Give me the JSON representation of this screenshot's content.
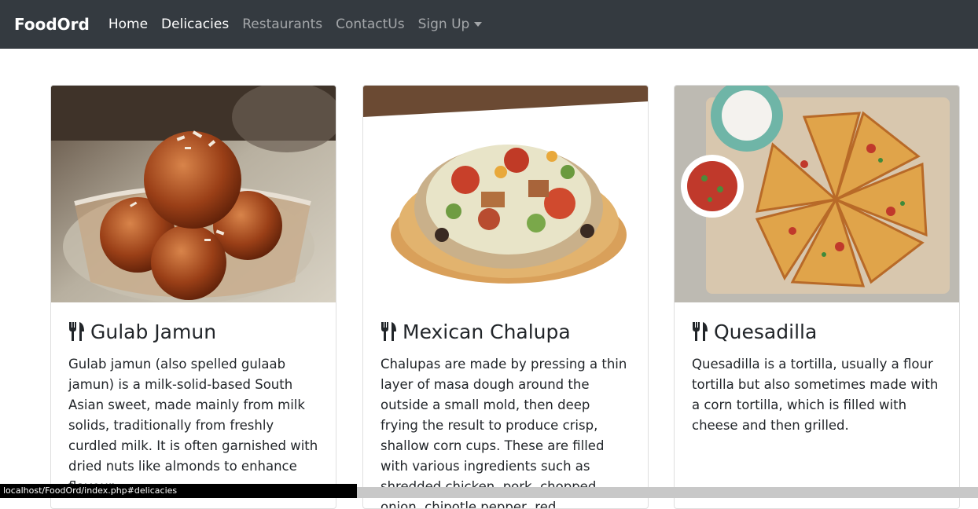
{
  "navbar": {
    "brand": "FoodOrd",
    "items": [
      {
        "label": "Home"
      },
      {
        "label": "Delicacies"
      },
      {
        "label": "Restaurants"
      },
      {
        "label": "ContactUs"
      },
      {
        "label": "Sign Up"
      }
    ]
  },
  "cards": [
    {
      "title": "Gulab Jamun",
      "text": "Gulab jamun (also spelled gulaab jamun) is a milk-solid-based South Asian sweet, made mainly from milk solids, traditionally from freshly curdled milk. It is often garnished with dried nuts like almonds to enhance flavour."
    },
    {
      "title": "Mexican Chalupa",
      "text": "Chalupas are made by pressing a thin layer of masa dough around the outside a small mold, then deep frying the result to produce crisp, shallow corn cups. These are filled with various ingredients such as shredded chicken, pork, chopped onion, chipotle pepper, red"
    },
    {
      "title": "Quesadilla",
      "text": "Quesadilla is a tortilla, usually a flour tortilla but also sometimes made with a corn tortilla, which is filled with cheese and then grilled."
    }
  ],
  "status": {
    "url": "localhost/FoodOrd/index.php#delicacies"
  }
}
